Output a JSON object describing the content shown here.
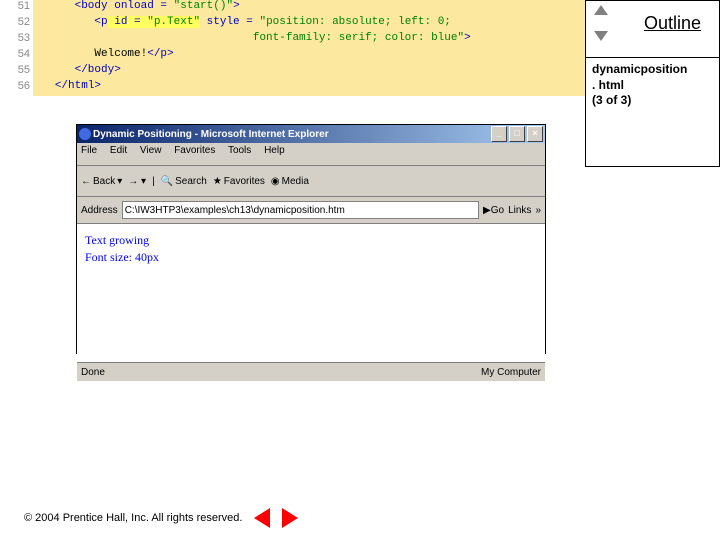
{
  "code": {
    "lines": [
      {
        "n": "51",
        "indent": "      ",
        "t1": "<body",
        "t2": " onload = ",
        "s": "\"start()\"",
        "t3": ">",
        "hl": false
      },
      {
        "n": "52",
        "indent": "         ",
        "t1": "<p",
        "t2": " id = ",
        "s": "\"p.Text\"",
        "t3": " style = ",
        "s2": "\"position: absolute; left: 0;",
        "hl": true
      },
      {
        "n": "53",
        "indent": "                                 ",
        "s": "font-family: serif; color: blue\"",
        "t3": ">",
        "hl": false
      },
      {
        "n": "54",
        "indent": "         ",
        "plain": "Welcome!",
        "t1": "</p>",
        "hl": false
      },
      {
        "n": "55",
        "indent": "      ",
        "t1": "</body>",
        "hl": false
      },
      {
        "n": "56",
        "indent": "   ",
        "t1": "</html>",
        "hl": false
      }
    ]
  },
  "outline": {
    "label": "Outline"
  },
  "file": {
    "name": "dynamicposition",
    "ext": ". html",
    "page": "(3 of 3)"
  },
  "ie": {
    "title": "Dynamic Positioning - Microsoft Internet Explorer",
    "menu": [
      "File",
      "Edit",
      "View",
      "Favorites",
      "Tools",
      "Help"
    ],
    "toolbar": {
      "back": "Back",
      "search": "Search",
      "fav": "Favorites",
      "media": "Media"
    },
    "addr_label": "Address",
    "addr_value": "C:\\IW3HTP3\\examples\\ch13\\dynamicposition.htm",
    "go": "Go",
    "links": "Links",
    "content_lines": [
      "Text growing",
      "Font size: 40px"
    ],
    "status_done": "Done",
    "status_zone": "My Computer"
  },
  "footer": {
    "copy": "© 2004 Prentice Hall, Inc.  All rights reserved."
  }
}
